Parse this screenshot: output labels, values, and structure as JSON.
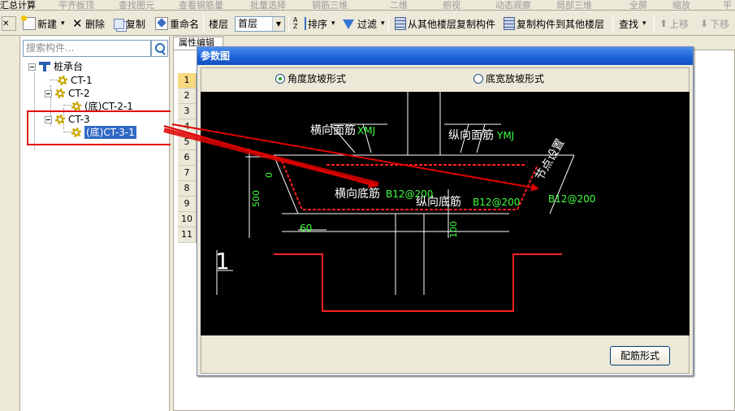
{
  "topbar": {
    "items": [
      "汇总计算",
      "平齐板顶",
      "查找图元",
      "查看钢筋量",
      "批量选择",
      "钢筋三维",
      "二维",
      "俯视",
      "动态观察",
      "局部三维",
      "全屏",
      "缩放",
      "平"
    ]
  },
  "toolbar": {
    "new": "新建",
    "delete": "删除",
    "copy": "复制",
    "rename": "重命名",
    "floor_label": "楼层",
    "floor_value": "首层",
    "sort": "排序",
    "filter": "过滤",
    "copy_from_other": "从其他楼层复制构件",
    "copy_to_other": "复制构件到其他楼层",
    "find": "查找",
    "move_up": "上移",
    "move_down": "下移"
  },
  "left_panel": {
    "search_placeholder": "搜索构件...",
    "tree": {
      "root": "桩承台",
      "children": [
        {
          "label": "CT-1"
        },
        {
          "label": "CT-2",
          "children": [
            {
              "label": "(底)CT-2-1"
            }
          ]
        },
        {
          "label": "CT-3",
          "children": [
            {
              "label": "(底)CT-3-1",
              "selected": true
            }
          ]
        }
      ]
    }
  },
  "property_tab": "属性编辑",
  "grid_rows": [
    "1",
    "2",
    "3",
    "4",
    "5",
    "6",
    "7",
    "8",
    "9",
    "10",
    "11"
  ],
  "dialog": {
    "title": "参数图",
    "option_angle": "角度放坡形式",
    "option_width": "底宽放坡形式",
    "selected_option": "角度放坡形式",
    "config_button": "配筋形式",
    "drawing": {
      "label_horiz_face": "横向面筋",
      "label_xmj": "XMJ",
      "label_vert_face": "纵向面筋",
      "label_ymj": "YMJ",
      "label_node": "节点设置",
      "label_horiz_bottom": "横向底筋",
      "label_b12_1": "B12@200",
      "label_vert_bottom": "纵向底筋",
      "label_b12_2": "B12@200",
      "label_b12_3": "B12@200",
      "dim_500": "500",
      "dim_0": "0",
      "dim_60": "60",
      "dim_100": "100",
      "section_label": "1"
    }
  },
  "colors": {
    "annotation_arrow": "#e00000",
    "highlight_box": "#e00000",
    "selection": "#316AC5",
    "rebar": "#ff2020",
    "cad_green": "#40ff40"
  }
}
